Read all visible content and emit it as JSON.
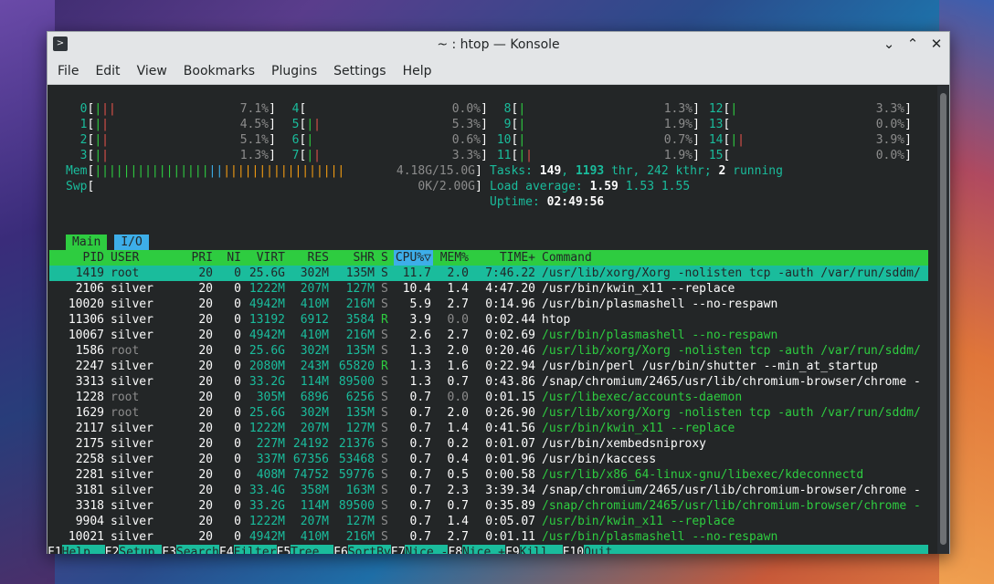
{
  "window": {
    "title": "~ : htop — Konsole",
    "app_icon": "terminal-icon",
    "buttons": [
      "chevron-down-icon",
      "maximize-icon",
      "close-icon"
    ]
  },
  "menubar": [
    "File",
    "Edit",
    "View",
    "Bookmarks",
    "Plugins",
    "Settings",
    "Help"
  ],
  "cpus": [
    {
      "id": "0",
      "pct": "7.1%"
    },
    {
      "id": "4",
      "pct": "0.0%"
    },
    {
      "id": "8",
      "pct": "1.3%"
    },
    {
      "id": "12",
      "pct": "3.3%"
    },
    {
      "id": "1",
      "pct": "4.5%"
    },
    {
      "id": "5",
      "pct": "5.3%"
    },
    {
      "id": "9",
      "pct": "1.9%"
    },
    {
      "id": "13",
      "pct": "0.0%"
    },
    {
      "id": "2",
      "pct": "5.1%"
    },
    {
      "id": "6",
      "pct": "0.6%"
    },
    {
      "id": "10",
      "pct": "0.7%"
    },
    {
      "id": "14",
      "pct": "3.9%"
    },
    {
      "id": "3",
      "pct": "1.3%"
    },
    {
      "id": "7",
      "pct": "3.3%"
    },
    {
      "id": "11",
      "pct": "1.9%"
    },
    {
      "id": "15",
      "pct": "0.0%"
    }
  ],
  "mem": {
    "label": "Mem",
    "value": "4.18G/15.0G"
  },
  "swp": {
    "label": "Swp",
    "value": "0K/2.00G"
  },
  "tasks": {
    "label": "Tasks:",
    "count": "149",
    "thr": "1193",
    "thr_label": "thr,",
    "kthr": "242",
    "kthr_label": "kthr;",
    "running": "2",
    "running_label": "running"
  },
  "load": {
    "label": "Load average:",
    "v1": "1.59",
    "v2": "1.53",
    "v3": "1.55"
  },
  "uptime": {
    "label": "Uptime:",
    "value": "02:49:56"
  },
  "tabs": [
    "Main",
    "I/O"
  ],
  "columns": [
    "PID",
    "USER",
    "PRI",
    "NI",
    "VIRT",
    "RES",
    "SHR",
    "S",
    "CPU%▽",
    "MEM%",
    "TIME+",
    "Command"
  ],
  "processes": [
    {
      "pid": "1419",
      "user": "root",
      "pri": "20",
      "ni": "0",
      "virt": "25.6G",
      "res": "302M",
      "shr": "135M",
      "s": "S",
      "cpu": "11.7",
      "mem": "2.0",
      "time": "7:46.22",
      "cmd": "/usr/lib/xorg/Xorg -nolisten tcp -auth /var/run/sddm/",
      "thread": false
    },
    {
      "pid": "2106",
      "user": "silver",
      "pri": "20",
      "ni": "0",
      "virt": "1222M",
      "res": "207M",
      "shr": "127M",
      "s": "S",
      "cpu": "10.4",
      "mem": "1.4",
      "time": "4:47.20",
      "cmd": "/usr/bin/kwin_x11 --replace",
      "thread": false
    },
    {
      "pid": "10020",
      "user": "silver",
      "pri": "20",
      "ni": "0",
      "virt": "4942M",
      "res": "410M",
      "shr": "216M",
      "s": "S",
      "cpu": "5.9",
      "mem": "2.7",
      "time": "0:14.96",
      "cmd": "/usr/bin/plasmashell --no-respawn",
      "thread": false
    },
    {
      "pid": "11306",
      "user": "silver",
      "pri": "20",
      "ni": "0",
      "virt": "13192",
      "res": "6912",
      "shr": "3584",
      "s": "R",
      "cpu": "3.9",
      "mem": "0.0",
      "time": "0:02.44",
      "cmd": "htop",
      "thread": false
    },
    {
      "pid": "10067",
      "user": "silver",
      "pri": "20",
      "ni": "0",
      "virt": "4942M",
      "res": "410M",
      "shr": "216M",
      "s": "S",
      "cpu": "2.6",
      "mem": "2.7",
      "time": "0:02.69",
      "cmd": "/usr/bin/plasmashell --no-respawn",
      "thread": true
    },
    {
      "pid": "1586",
      "user": "root",
      "pri": "20",
      "ni": "0",
      "virt": "25.6G",
      "res": "302M",
      "shr": "135M",
      "s": "S",
      "cpu": "1.3",
      "mem": "2.0",
      "time": "0:20.46",
      "cmd": "/usr/lib/xorg/Xorg -nolisten tcp -auth /var/run/sddm/",
      "thread": true
    },
    {
      "pid": "2247",
      "user": "silver",
      "pri": "20",
      "ni": "0",
      "virt": "2080M",
      "res": "243M",
      "shr": "65820",
      "s": "R",
      "cpu": "1.3",
      "mem": "1.6",
      "time": "0:22.94",
      "cmd": "/usr/bin/perl /usr/bin/shutter --min_at_startup",
      "thread": false
    },
    {
      "pid": "3313",
      "user": "silver",
      "pri": "20",
      "ni": "0",
      "virt": "33.2G",
      "res": "114M",
      "shr": "89500",
      "s": "S",
      "cpu": "1.3",
      "mem": "0.7",
      "time": "0:43.86",
      "cmd": "/snap/chromium/2465/usr/lib/chromium-browser/chrome -",
      "thread": false
    },
    {
      "pid": "1228",
      "user": "root",
      "pri": "20",
      "ni": "0",
      "virt": "305M",
      "res": "6896",
      "shr": "6256",
      "s": "S",
      "cpu": "0.7",
      "mem": "0.0",
      "time": "0:01.15",
      "cmd": "/usr/libexec/accounts-daemon",
      "thread": true
    },
    {
      "pid": "1629",
      "user": "root",
      "pri": "20",
      "ni": "0",
      "virt": "25.6G",
      "res": "302M",
      "shr": "135M",
      "s": "S",
      "cpu": "0.7",
      "mem": "2.0",
      "time": "0:26.90",
      "cmd": "/usr/lib/xorg/Xorg -nolisten tcp -auth /var/run/sddm/",
      "thread": true
    },
    {
      "pid": "2117",
      "user": "silver",
      "pri": "20",
      "ni": "0",
      "virt": "1222M",
      "res": "207M",
      "shr": "127M",
      "s": "S",
      "cpu": "0.7",
      "mem": "1.4",
      "time": "0:41.56",
      "cmd": "/usr/bin/kwin_x11 --replace",
      "thread": true
    },
    {
      "pid": "2175",
      "user": "silver",
      "pri": "20",
      "ni": "0",
      "virt": "227M",
      "res": "24192",
      "shr": "21376",
      "s": "S",
      "cpu": "0.7",
      "mem": "0.2",
      "time": "0:01.07",
      "cmd": "/usr/bin/xembedsniproxy",
      "thread": false
    },
    {
      "pid": "2258",
      "user": "silver",
      "pri": "20",
      "ni": "0",
      "virt": "337M",
      "res": "67356",
      "shr": "53468",
      "s": "S",
      "cpu": "0.7",
      "mem": "0.4",
      "time": "0:01.96",
      "cmd": "/usr/bin/kaccess",
      "thread": false
    },
    {
      "pid": "2281",
      "user": "silver",
      "pri": "20",
      "ni": "0",
      "virt": "408M",
      "res": "74752",
      "shr": "59776",
      "s": "S",
      "cpu": "0.7",
      "mem": "0.5",
      "time": "0:00.58",
      "cmd": "/usr/lib/x86_64-linux-gnu/libexec/kdeconnectd",
      "thread": true
    },
    {
      "pid": "3181",
      "user": "silver",
      "pri": "20",
      "ni": "0",
      "virt": "33.4G",
      "res": "358M",
      "shr": "163M",
      "s": "S",
      "cpu": "0.7",
      "mem": "2.3",
      "time": "3:39.34",
      "cmd": "/snap/chromium/2465/usr/lib/chromium-browser/chrome -",
      "thread": false
    },
    {
      "pid": "3318",
      "user": "silver",
      "pri": "20",
      "ni": "0",
      "virt": "33.2G",
      "res": "114M",
      "shr": "89500",
      "s": "S",
      "cpu": "0.7",
      "mem": "0.7",
      "time": "0:35.89",
      "cmd": "/snap/chromium/2465/usr/lib/chromium-browser/chrome -",
      "thread": true
    },
    {
      "pid": "9904",
      "user": "silver",
      "pri": "20",
      "ni": "0",
      "virt": "1222M",
      "res": "207M",
      "shr": "127M",
      "s": "S",
      "cpu": "0.7",
      "mem": "1.4",
      "time": "0:05.07",
      "cmd": "/usr/bin/kwin_x11 --replace",
      "thread": true
    },
    {
      "pid": "10021",
      "user": "silver",
      "pri": "20",
      "ni": "0",
      "virt": "4942M",
      "res": "410M",
      "shr": "216M",
      "s": "S",
      "cpu": "0.7",
      "mem": "2.7",
      "time": "0:01.11",
      "cmd": "/usr/bin/plasmashell --no-respawn",
      "thread": true
    }
  ],
  "footer": [
    {
      "key": "F1",
      "label": "Help  "
    },
    {
      "key": "F2",
      "label": "Setup "
    },
    {
      "key": "F3",
      "label": "Search"
    },
    {
      "key": "F4",
      "label": "Filter"
    },
    {
      "key": "F5",
      "label": "Tree  "
    },
    {
      "key": "F6",
      "label": "SortBy"
    },
    {
      "key": "F7",
      "label": "Nice -"
    },
    {
      "key": "F8",
      "label": "Nice +"
    },
    {
      "key": "F9",
      "label": "Kill  "
    },
    {
      "key": "F10",
      "label": "Quit"
    }
  ],
  "colors": {
    "terminal_bg": "#232627",
    "accent_green": "#2ecc40",
    "accent_teal": "#1abc9c",
    "accent_blue": "#3daee9"
  }
}
